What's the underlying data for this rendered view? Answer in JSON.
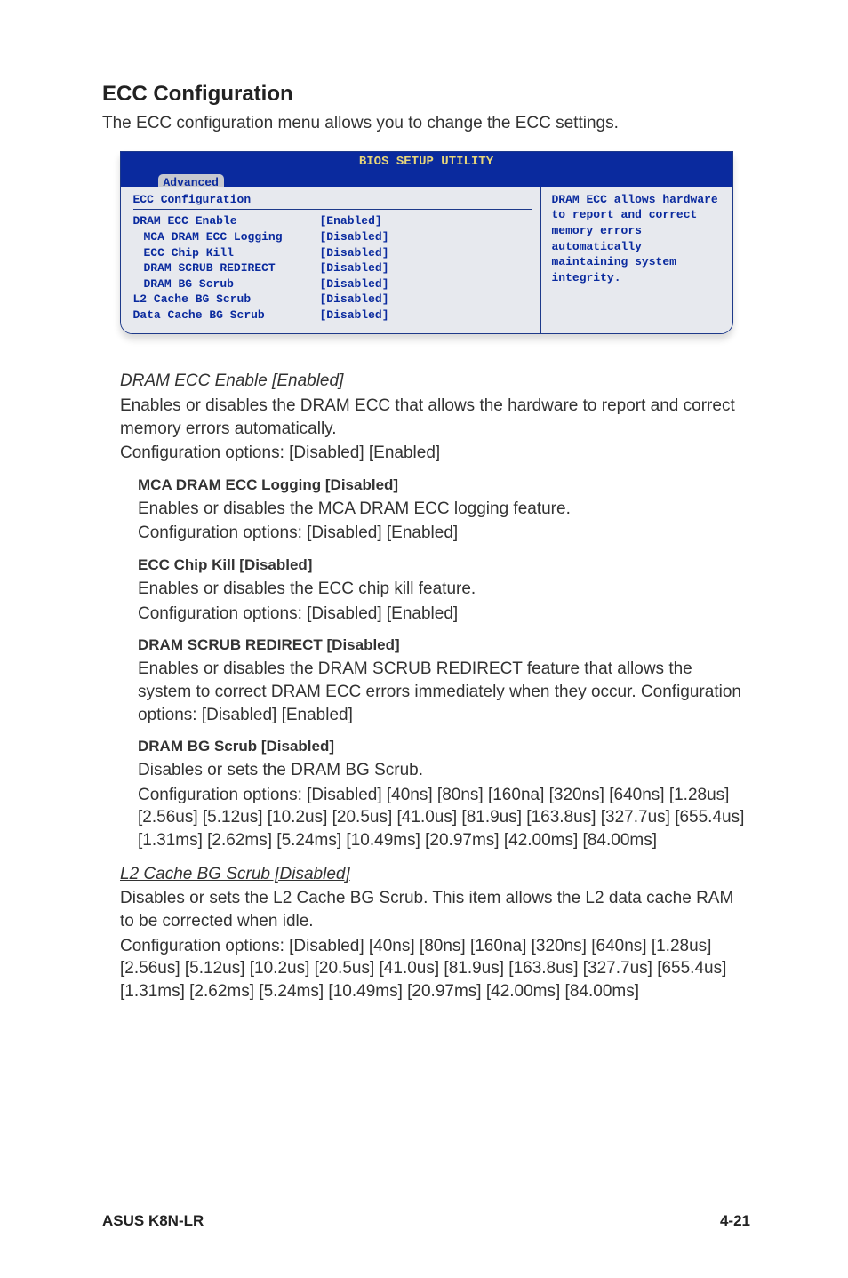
{
  "heading": "ECC Configuration",
  "intro": "The ECC configuration menu allows you to change the ECC settings.",
  "bios": {
    "title": "BIOS SETUP UTILITY",
    "tab": "Advanced",
    "group_title": "ECC Configuration",
    "rows": [
      {
        "label": "DRAM ECC Enable",
        "value": "[Enabled]",
        "indent": false
      },
      {
        "label": "MCA DRAM ECC Logging",
        "value": "[Disabled]",
        "indent": true
      },
      {
        "label": "ECC Chip Kill",
        "value": "[Disabled]",
        "indent": true
      },
      {
        "label": "DRAM SCRUB REDIRECT",
        "value": "[Disabled]",
        "indent": true
      },
      {
        "label": "DRAM BG Scrub",
        "value": "[Disabled]",
        "indent": true
      },
      {
        "label": "L2 Cache BG Scrub",
        "value": "[Disabled]",
        "indent": false
      },
      {
        "label": "Data Cache BG Scrub",
        "value": "[Disabled]",
        "indent": false
      }
    ],
    "help": "DRAM ECC allows hardware to report and correct memory errors automatically maintaining system integrity."
  },
  "sections": {
    "dram_ecc": {
      "title": "DRAM ECC Enable [Enabled]",
      "p1": "Enables or disables the DRAM ECC that allows the hardware to report and correct memory errors automatically.",
      "p2": "Configuration options: [Disabled] [Enabled]"
    },
    "mca": {
      "title": "MCA DRAM ECC Logging [Disabled]",
      "p1": "Enables or disables the MCA DRAM ECC logging feature.",
      "p2": "Configuration options: [Disabled] [Enabled]"
    },
    "chipkill": {
      "title": "ECC Chip Kill [Disabled]",
      "p1": "Enables or disables the ECC chip kill feature.",
      "p2": "Configuration options: [Disabled] [Enabled]"
    },
    "scrubredir": {
      "title": "DRAM SCRUB REDIRECT [Disabled]",
      "p1": "Enables or disables the DRAM SCRUB REDIRECT feature that allows the system to correct DRAM ECC errors immediately when they occur. Configuration options: [Disabled] [Enabled]"
    },
    "bgscrub": {
      "title": "DRAM BG Scrub [Disabled]",
      "p1": "Disables or sets the DRAM BG Scrub.",
      "p2": "Configuration options: [Disabled] [40ns] [80ns] [160na] [320ns] [640ns] [1.28us] [2.56us] [5.12us] [10.2us] [20.5us] [41.0us] [81.9us] [163.8us] [327.7us] [655.4us] [1.31ms] [2.62ms] [5.24ms] [10.49ms] [20.97ms] [42.00ms] [84.00ms]"
    },
    "l2scrub": {
      "title": "L2 Cache BG Scrub [Disabled]",
      "p1": "Disables or sets the L2 Cache BG Scrub. This item allows the L2 data cache RAM to be corrected when idle.",
      "p2": "Configuration options: [Disabled] [40ns] [80ns] [160na] [320ns] [640ns] [1.28us] [2.56us] [5.12us] [10.2us] [20.5us] [41.0us] [81.9us] [163.8us] [327.7us] [655.4us] [1.31ms] [2.62ms] [5.24ms] [10.49ms] [20.97ms] [42.00ms] [84.00ms]"
    }
  },
  "footer": {
    "left": "ASUS K8N-LR",
    "right": "4-21"
  }
}
